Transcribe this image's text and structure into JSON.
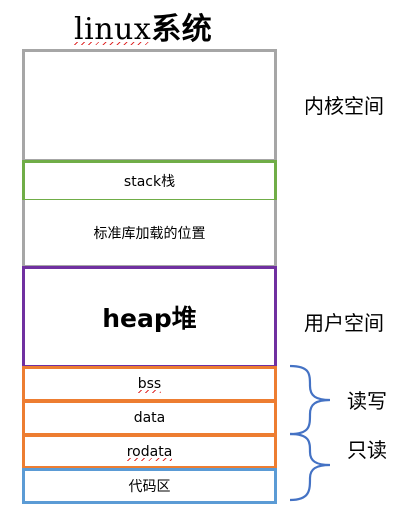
{
  "title": {
    "latin": "linux",
    "cjk": "系统"
  },
  "regions": [
    {
      "id": "kernel",
      "label": ""
    },
    {
      "id": "stack",
      "label": "stack栈"
    },
    {
      "id": "stdlib",
      "label": "标准库加载的位置"
    },
    {
      "id": "heap",
      "label": "heap堆"
    },
    {
      "id": "bss",
      "label": "bss"
    },
    {
      "id": "data",
      "label": "data"
    },
    {
      "id": "rodata",
      "label": "rodata"
    },
    {
      "id": "code",
      "label": "代码区"
    }
  ],
  "side_labels": {
    "kernel_space": "内核空间",
    "user_space": "用户空间",
    "read_write": "读写",
    "read_only": "只读"
  },
  "colors": {
    "gray": "#a6a6a6",
    "green": "#70ad47",
    "purple": "#7030a0",
    "orange": "#ed7d31",
    "blue": "#5b9bd5",
    "brace": "#4472c4"
  }
}
